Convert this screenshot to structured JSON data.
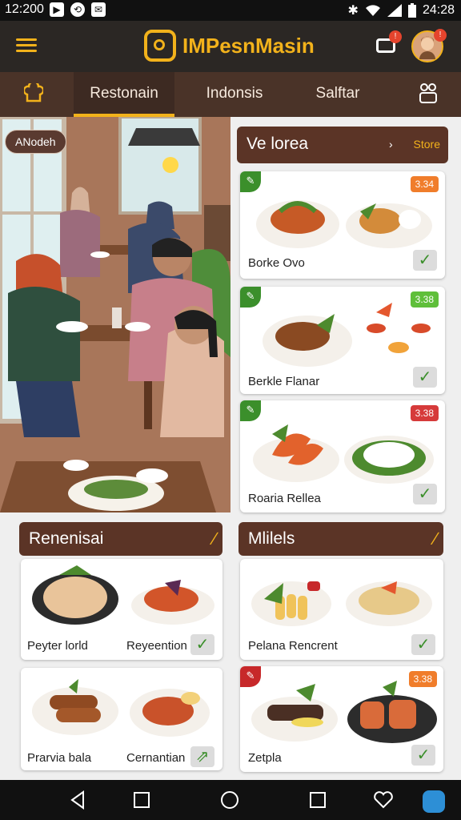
{
  "status": {
    "time": "12:200",
    "battery_time": "24:28"
  },
  "app": {
    "brand": "IMPesnMasin"
  },
  "tabs": [
    {
      "label": "Restonain"
    },
    {
      "label": "Indonsis"
    },
    {
      "label": "Salftar"
    }
  ],
  "hero": {
    "tag": "ANodeh"
  },
  "featured": {
    "header": "Ve lorea",
    "header_link": "Store",
    "cards": [
      {
        "name": "Borke Ovo",
        "price": "3.34",
        "price_color": "#f07d2b"
      },
      {
        "name": "Berkle Flanar",
        "price": "3.38",
        "price_color": "#5fbf3a"
      },
      {
        "name": "Roaria Rellea",
        "price": "3.38",
        "price_color": "#d63a3a"
      }
    ]
  },
  "section_left": {
    "header": "Renenisai",
    "cards": [
      {
        "name_left": "Peyter lorld",
        "name_right": "Reyeention"
      },
      {
        "name_left": "Prarvia bala",
        "name_right": "Cernantian"
      }
    ]
  },
  "section_right": {
    "header": "Mlilels",
    "cards": [
      {
        "name": "Pelana Rencrent"
      },
      {
        "name": "Zetpla",
        "price": "3.38",
        "price_color": "#f07d2b"
      }
    ]
  }
}
